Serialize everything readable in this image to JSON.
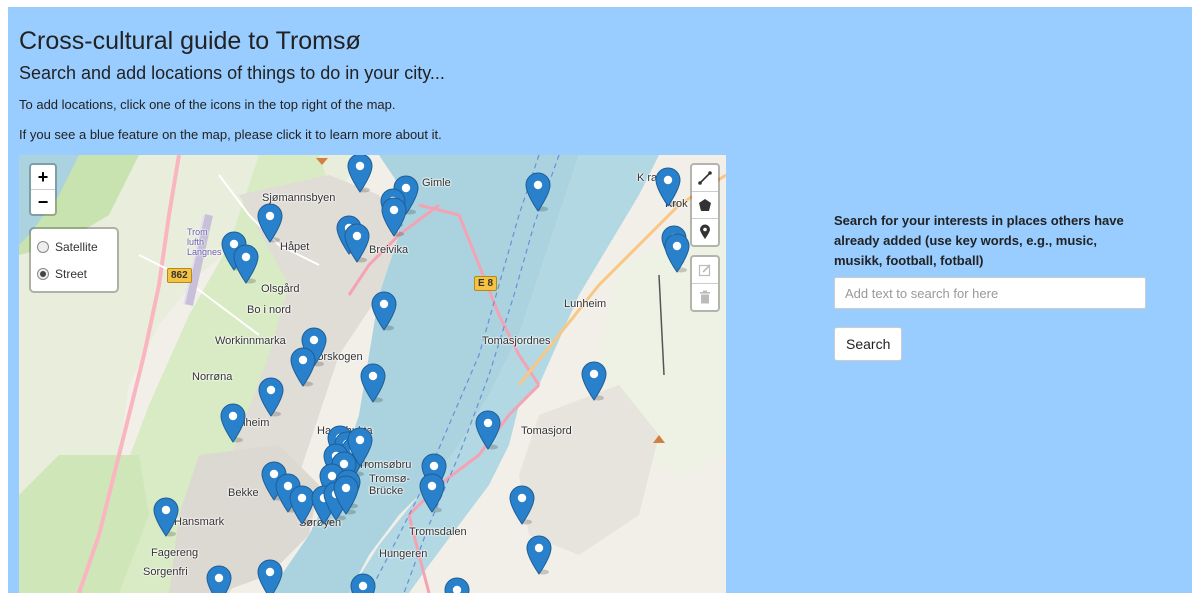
{
  "header": {
    "title": "Cross-cultural guide to Tromsø",
    "subtitle": "Search and add locations of things to do in your city...",
    "instruction_1": "To add locations, click one of the icons in the top right of the map.",
    "instruction_2": "If you see a blue feature on the map, please click it to learn more about it."
  },
  "map": {
    "zoom_in": "+",
    "zoom_out": "−",
    "layers": [
      {
        "label": "Satellite",
        "selected": false
      },
      {
        "label": "Street",
        "selected": true
      }
    ],
    "place_labels": {
      "sjomannsbyen": "Sjømannsbyen",
      "gimle": "Gimle",
      "krok": "Krok",
      "hapet": "Håpet",
      "breivika": "Breivika",
      "olsgard": "Olsgård",
      "bo_i_nord": "Bo i nord",
      "lunheim": "Lunheim",
      "workinnmarka": "Workinnmarka",
      "storskogen": "Storskogen",
      "tomasjordnes": "Tomasjordnes",
      "norrona": "Norrøna",
      "alheim": "alheim",
      "hanesbukta": "Ha  esbukta",
      "tomasjord": "Tomasjord",
      "tromsobrua": "Tromsøbru",
      "tromso_brucke": "Tromsø-\nBrücke",
      "bekke": "Bekke",
      "o": "ø",
      "hansmark": "Hansmark",
      "soroyen": "Sørøyen",
      "tromsdalen": "Tromsdalen",
      "hungeren": "Hungeren",
      "fagereng": "Fagereng",
      "sorgenfri": "Sorgenfri",
      "lufthavn": "Trom\nlufth\nLangnes",
      "kro_top": "K    ran"
    },
    "road_shields": {
      "r862": "862",
      "e8": "E 8"
    },
    "marker_color": "#2a81cb",
    "draw_tools": [
      "polyline-icon",
      "polygon-icon",
      "marker-icon"
    ],
    "edit_tools": [
      "edit-icon",
      "trash-icon"
    ]
  },
  "search": {
    "prompt": "Search for your interests in places others have already added (use key words, e.g., music, musikk, football, fotball)",
    "placeholder": "Add text to search for here",
    "button_label": "Search"
  }
}
